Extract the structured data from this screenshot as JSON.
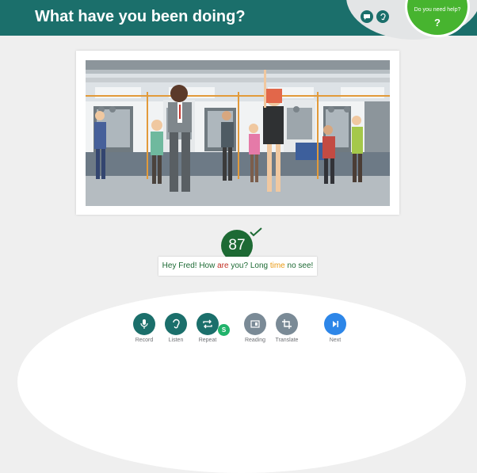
{
  "header": {
    "title": "What have you been doing?"
  },
  "help": {
    "label": "Do you need help?",
    "symbol": "?"
  },
  "header_icons": [
    "chat-bubble-icon",
    "ear-icon"
  ],
  "result": {
    "score": "87",
    "sentence": [
      {
        "text": "Hey Fred! How ",
        "status": "correct"
      },
      {
        "text": "are",
        "status": "error"
      },
      {
        "text": " you? Long ",
        "status": "correct"
      },
      {
        "text": "time",
        "status": "warning"
      },
      {
        "text": " no see!",
        "status": "correct"
      }
    ]
  },
  "controls": {
    "record": {
      "label": "Record",
      "icon": "microphone-icon"
    },
    "listen": {
      "label": "Listen",
      "icon": "ear-icon"
    },
    "repeat": {
      "label": "Repeat",
      "icon": "repeat-icon",
      "badge": "S"
    },
    "reading": {
      "label": "Reading",
      "icon": "reading-icon"
    },
    "translate": {
      "label": "Translate",
      "icon": "crop-icon"
    },
    "next": {
      "label": "Next",
      "icon": "skip-next-icon"
    }
  },
  "colors": {
    "header_bg": "#1b6f6b",
    "help_bg": "#47b42f",
    "score_bg": "#1d6a34",
    "primary_button": "#1b6f6b",
    "disabled_button": "#7a8a96",
    "next_button": "#2d86e8",
    "badge": "#21b36b",
    "word_error": "#c22f24",
    "word_warning": "#e99a14"
  }
}
